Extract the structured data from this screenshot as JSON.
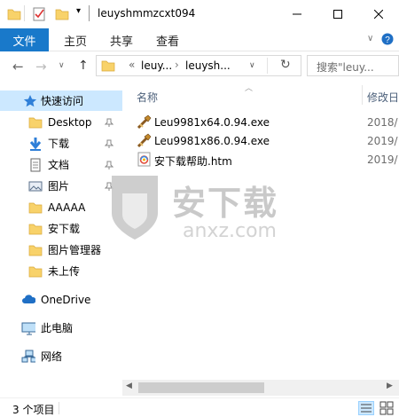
{
  "window": {
    "title": "leuyshmmzcxt094",
    "minimize_label": "─",
    "maximize_label": "☐",
    "close_label": "✕"
  },
  "ribbon": {
    "tabs": [
      {
        "label": "文件"
      },
      {
        "label": "主页"
      },
      {
        "label": "共享"
      },
      {
        "label": "查看"
      }
    ]
  },
  "address_bar": {
    "prefix": "«",
    "crumbs": [
      "leuy...",
      "leuysh..."
    ],
    "search_placeholder": "搜索\"leuy..."
  },
  "sidebar": {
    "items": [
      {
        "label": "快速访问",
        "icon": "star-icon",
        "pinned": false
      },
      {
        "label": "Desktop",
        "icon": "folder-icon",
        "pinned": true
      },
      {
        "label": "下载",
        "icon": "download-arrow-icon",
        "pinned": true
      },
      {
        "label": "文档",
        "icon": "document-icon",
        "pinned": true
      },
      {
        "label": "图片",
        "icon": "pictures-icon",
        "pinned": true
      },
      {
        "label": "AAAAA",
        "icon": "folder-icon",
        "pinned": false
      },
      {
        "label": "安下载",
        "icon": "folder-icon",
        "pinned": false
      },
      {
        "label": "图片管理器",
        "icon": "folder-icon",
        "pinned": false
      },
      {
        "label": "未上传",
        "icon": "folder-icon",
        "pinned": false
      },
      {
        "label": "OneDrive",
        "icon": "cloud-icon",
        "pinned": false
      },
      {
        "label": "此电脑",
        "icon": "computer-icon",
        "pinned": false
      },
      {
        "label": "网络",
        "icon": "network-icon",
        "pinned": false
      }
    ]
  },
  "file_list": {
    "columns": [
      "名称",
      "修改日"
    ],
    "files": [
      {
        "name": "Leu9981x64.0.94.exe",
        "date": "2018/",
        "icon": "installer-exe-icon"
      },
      {
        "name": "Leu9981x86.0.94.exe",
        "date": "2019/",
        "icon": "installer-exe-icon"
      },
      {
        "name": "安下载帮助.htm",
        "date": "2019/",
        "icon": "htm-file-icon"
      }
    ]
  },
  "watermark": {
    "logo_text": "安下载",
    "url_text": "anxz.com"
  },
  "status": {
    "item_count": "3 个项目"
  },
  "colors": {
    "file_tab": "#1979ca",
    "selection": "#cce8ff",
    "folder": "#f8d26a",
    "accent_blue": "#1f6fc5"
  }
}
